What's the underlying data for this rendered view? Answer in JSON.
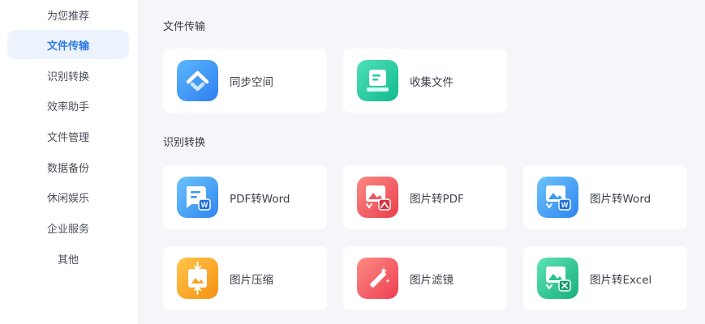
{
  "sidebar": {
    "items": [
      {
        "label": "为您推荐",
        "active": false
      },
      {
        "label": "文件传输",
        "active": true
      },
      {
        "label": "识别转换",
        "active": false
      },
      {
        "label": "效率助手",
        "active": false
      },
      {
        "label": "文件管理",
        "active": false
      },
      {
        "label": "数据备份",
        "active": false
      },
      {
        "label": "休闲娱乐",
        "active": false
      },
      {
        "label": "企业服务",
        "active": false
      },
      {
        "label": "其他",
        "active": false
      }
    ]
  },
  "sections": [
    {
      "title": "文件传输",
      "cards": [
        {
          "label": "同步空间",
          "icon": "sync-space-icon",
          "color": "#2f8df5"
        },
        {
          "label": "收集文件",
          "icon": "collect-files-icon",
          "color": "#1fc9a0"
        }
      ]
    },
    {
      "title": "识别转换",
      "cards": [
        {
          "label": "PDF转Word",
          "icon": "pdf-to-word-icon",
          "color": "#3b9bf0"
        },
        {
          "label": "图片转PDF",
          "icon": "image-to-pdf-icon",
          "color": "#f0555d"
        },
        {
          "label": "图片转Word",
          "icon": "image-to-word-icon",
          "color": "#3b9bf0"
        },
        {
          "label": "图片压缩",
          "icon": "image-compress-icon",
          "color": "#f7a623"
        },
        {
          "label": "图片滤镜",
          "icon": "image-filter-icon",
          "color": "#f35d62"
        },
        {
          "label": "图片转Excel",
          "icon": "image-to-excel-icon",
          "color": "#25c38d"
        }
      ]
    }
  ]
}
